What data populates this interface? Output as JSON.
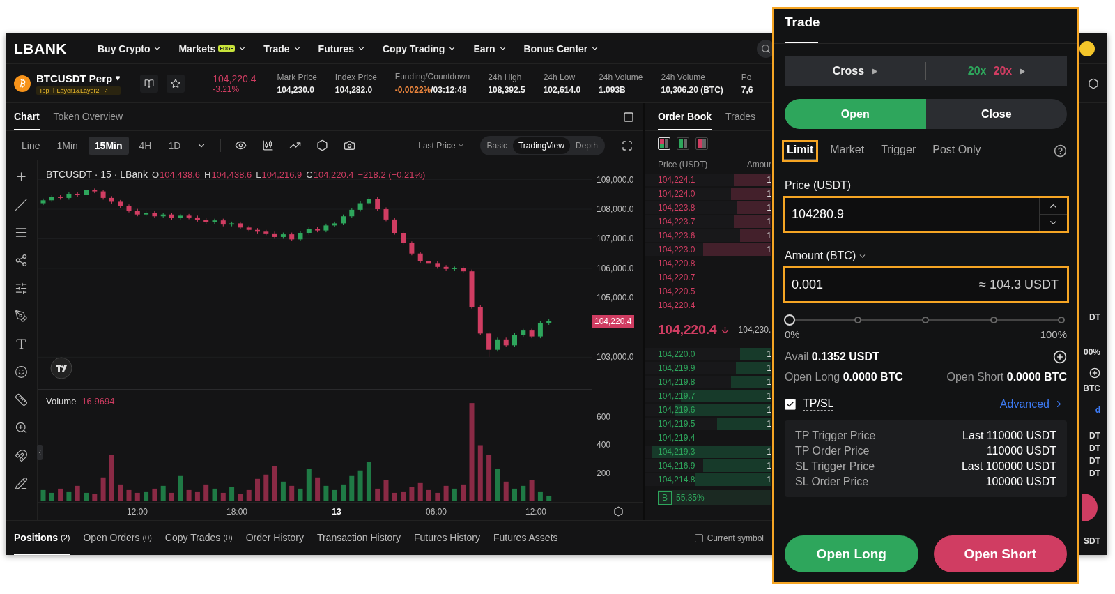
{
  "nav": {
    "logo": "LBANK",
    "items": [
      {
        "label": "Buy Crypto"
      },
      {
        "label": "Markets",
        "badge": "EDGE"
      },
      {
        "label": "Trade"
      },
      {
        "label": "Futures"
      },
      {
        "label": "Copy Trading"
      },
      {
        "label": "Earn"
      },
      {
        "label": "Bonus Center"
      }
    ]
  },
  "ticker": {
    "symbol": "BTCUSDT Perp",
    "tags": [
      "Top",
      "Layer1&Layer2"
    ],
    "price": "104,220.4",
    "change": "-3.21%",
    "stats": [
      {
        "kind": "plain",
        "label": "Mark Price",
        "value": "104,230.0"
      },
      {
        "kind": "plain",
        "label": "Index Price",
        "value": "104,282.0"
      },
      {
        "kind": "funding",
        "label": "Funding/Countdown",
        "value": "-0.0022%",
        "suffix": "/03:12:48"
      },
      {
        "kind": "plain",
        "label": "24h High",
        "value": "108,392.5"
      },
      {
        "kind": "plain",
        "label": "24h Low",
        "value": "102,614.0"
      },
      {
        "kind": "plain",
        "label": "24h Volume",
        "value": "1.093B"
      },
      {
        "kind": "plain",
        "label": "24h Volume",
        "value": "10,306.20 (BTC)"
      },
      {
        "kind": "plain",
        "label": "Po",
        "value": "7,6"
      }
    ]
  },
  "chart": {
    "tabs": [
      {
        "label": "Chart",
        "selected": true
      },
      {
        "label": "Token Overview",
        "selected": false
      }
    ],
    "intervals": [
      {
        "label": "Line",
        "selected": false
      },
      {
        "label": "1Min",
        "selected": false
      },
      {
        "label": "15Min",
        "selected": true
      },
      {
        "label": "4H",
        "selected": false
      },
      {
        "label": "1D",
        "selected": false
      }
    ],
    "price_source": "Last Price",
    "views": [
      {
        "label": "Basic",
        "selected": false
      },
      {
        "label": "TradingView",
        "selected": true
      },
      {
        "label": "Depth",
        "selected": false
      }
    ],
    "legend": {
      "symbol": "BTCUSDT · 15 · LBank",
      "ohlc": [
        {
          "key": "O",
          "value": "104,438.6"
        },
        {
          "key": "H",
          "value": "104,438.6"
        },
        {
          "key": "L",
          "value": "104,216.9"
        },
        {
          "key": "C",
          "value": "104,220.4"
        }
      ],
      "change": "−218.2 (−0.21%)"
    },
    "chart_data": {
      "type": "candlestick",
      "ylim": [
        101900,
        109650
      ],
      "grid": true,
      "yticks": [
        {
          "value": 109000,
          "label": "109,000.0"
        },
        {
          "value": 108000,
          "label": "108,000.0"
        },
        {
          "value": 107000,
          "label": "107,000.0"
        },
        {
          "value": 106000,
          "label": "106,000.0"
        },
        {
          "value": 105000,
          "label": "105,000.0"
        },
        {
          "value": 103000,
          "label": "103,000.0"
        }
      ],
      "ohlc": [
        [
          108200,
          108360,
          108140,
          108300
        ],
        [
          108300,
          108480,
          108240,
          108420
        ],
        [
          108420,
          108480,
          108320,
          108380
        ],
        [
          108380,
          108580,
          108320,
          108520
        ],
        [
          108520,
          108580,
          108420,
          108480
        ],
        [
          108480,
          108700,
          108420,
          108640
        ],
        [
          108640,
          108700,
          108540,
          108600
        ],
        [
          108600,
          108660,
          108320,
          108380
        ],
        [
          108380,
          108440,
          108190,
          108250
        ],
        [
          108250,
          108310,
          108040,
          108100
        ],
        [
          108100,
          108160,
          107890,
          107950
        ],
        [
          107950,
          108010,
          107760,
          107820
        ],
        [
          107820,
          107940,
          107760,
          107880
        ],
        [
          107880,
          107940,
          107700,
          107760
        ],
        [
          107760,
          107880,
          107700,
          107820
        ],
        [
          107820,
          107880,
          107640,
          107700
        ],
        [
          107700,
          107840,
          107640,
          107780
        ],
        [
          107780,
          107840,
          107660,
          107720
        ],
        [
          107720,
          107780,
          107580,
          107640
        ],
        [
          107640,
          107700,
          107500,
          107560
        ],
        [
          107560,
          107680,
          107500,
          107620
        ],
        [
          107620,
          107680,
          107420,
          107480
        ],
        [
          107480,
          107580,
          107420,
          107520
        ],
        [
          107520,
          107580,
          107320,
          107380
        ],
        [
          107380,
          107440,
          107240,
          107300
        ],
        [
          107300,
          107360,
          107180,
          107240
        ],
        [
          107240,
          107300,
          107120,
          107180
        ],
        [
          107180,
          107240,
          107000,
          107060
        ],
        [
          107060,
          107210,
          107000,
          107150
        ],
        [
          107150,
          107210,
          106920,
          106980
        ],
        [
          106980,
          107260,
          106920,
          107200
        ],
        [
          107200,
          107400,
          107140,
          107340
        ],
        [
          107340,
          107400,
          107220,
          107280
        ],
        [
          107280,
          107510,
          107220,
          107450
        ],
        [
          107450,
          107580,
          107390,
          107520
        ],
        [
          107520,
          107820,
          107460,
          107760
        ],
        [
          107760,
          108040,
          107700,
          107980
        ],
        [
          107980,
          108260,
          107920,
          108200
        ],
        [
          108200,
          108410,
          108140,
          108350
        ],
        [
          108350,
          108410,
          107940,
          108000
        ],
        [
          108000,
          108060,
          107590,
          107650
        ],
        [
          107650,
          107710,
          107140,
          107200
        ],
        [
          107200,
          107260,
          106790,
          106850
        ],
        [
          106850,
          106910,
          106440,
          106500
        ],
        [
          106500,
          106560,
          106190,
          106250
        ],
        [
          106250,
          106310,
          106120,
          106180
        ],
        [
          106180,
          106240,
          105990,
          106050
        ],
        [
          106050,
          106110,
          105920,
          105980
        ],
        [
          105980,
          106060,
          105920,
          106000
        ],
        [
          106000,
          106060,
          105840,
          105900
        ],
        [
          105900,
          105960,
          104640,
          104700
        ],
        [
          104700,
          104760,
          103740,
          103800
        ],
        [
          103800,
          103860,
          103010,
          103250
        ],
        [
          103250,
          103660,
          103190,
          103600
        ],
        [
          103600,
          103660,
          103340,
          103400
        ],
        [
          103400,
          103810,
          103340,
          103750
        ],
        [
          103750,
          103960,
          103690,
          103900
        ],
        [
          103900,
          103960,
          103640,
          103700
        ],
        [
          103700,
          104210,
          103640,
          104150
        ],
        [
          104150,
          104300,
          104090,
          104220
        ]
      ]
    },
    "time_axis": [
      {
        "label": "12:00",
        "bold": false
      },
      {
        "label": "18:00",
        "bold": false
      },
      {
        "label": "13",
        "bold": true
      },
      {
        "label": "06:00",
        "bold": false
      },
      {
        "label": "12:00",
        "bold": false
      }
    ],
    "last_price_tag": "104,220.4",
    "volume": {
      "label": "Volume",
      "value": "16.9694",
      "chart_data": {
        "type": "bar",
        "ylim": [
          0,
          790
        ],
        "yticks": [
          {
            "value": 600,
            "label": "600"
          },
          {
            "value": 400,
            "label": "400"
          },
          {
            "value": 200,
            "label": "200"
          }
        ],
        "values": [
          80,
          60,
          90,
          70,
          110,
          60,
          50,
          170,
          330,
          120,
          80,
          60,
          70,
          90,
          110,
          60,
          180,
          80,
          70,
          120,
          90,
          60,
          100,
          50,
          80,
          160,
          190,
          250,
          140,
          110,
          90,
          230,
          170,
          110,
          80,
          120,
          180,
          220,
          280,
          90,
          150,
          60,
          70,
          100,
          130,
          80,
          60,
          110,
          90,
          120,
          700,
          400,
          330,
          230,
          140,
          90,
          110,
          150,
          70,
          40
        ]
      }
    }
  },
  "order_book": {
    "tabs": [
      {
        "label": "Order Book",
        "selected": true
      },
      {
        "label": "Trades",
        "selected": false
      }
    ],
    "layouts": [
      {
        "kind": "both",
        "selected": true
      },
      {
        "kind": "bids",
        "selected": false
      },
      {
        "kind": "asks",
        "selected": false
      }
    ],
    "columns": [
      "Price (USDT)",
      "Amour"
    ],
    "asks": [
      {
        "price": "104,224.1",
        "amount": "1",
        "level": 0.3
      },
      {
        "price": "104,224.0",
        "amount": "1",
        "level": 0.32
      },
      {
        "price": "104,223.8",
        "amount": "1",
        "level": 0.27
      },
      {
        "price": "104,223.7",
        "amount": "1",
        "level": 0.3
      },
      {
        "price": "104,223.6",
        "amount": "1",
        "level": 0.25
      },
      {
        "price": "104,223.0",
        "amount": "1",
        "level": 0.54
      },
      {
        "price": "104,220.8"
      },
      {
        "price": "104,220.7"
      },
      {
        "price": "104,220.5"
      },
      {
        "price": "104,220.4"
      }
    ],
    "mid": {
      "price": "104,220.4",
      "mark": "104,230."
    },
    "bids": [
      {
        "price": "104,220.0",
        "amount": "1",
        "level": 0.25
      },
      {
        "price": "104,219.9",
        "amount": "1",
        "level": 0.28
      },
      {
        "price": "104,219.8",
        "amount": "1",
        "level": 0.32
      },
      {
        "price": "104,219.7",
        "amount": "1",
        "level": 0.72
      },
      {
        "price": "104,219.6",
        "amount": "1",
        "level": 0.77
      },
      {
        "price": "104,219.5",
        "amount": "1",
        "level": 0.43
      },
      {
        "price": "104,219.4"
      },
      {
        "price": "104,219.3",
        "amount": "1",
        "level": 0.95
      },
      {
        "price": "104,216.9",
        "amount": "1",
        "level": 0.54
      },
      {
        "price": "104,214.8",
        "amount": "1",
        "level": 0.6
      }
    ],
    "buy_ratio": {
      "label": "B",
      "value": "55.35%"
    }
  },
  "bottom_tabs": [
    {
      "label": "Positions",
      "count": "(2)",
      "selected": true
    },
    {
      "label": "Open Orders",
      "count": "(0)",
      "selected": false
    },
    {
      "label": "Copy Trades",
      "count": "(0)",
      "selected": false
    },
    {
      "label": "Order History",
      "selected": false
    },
    {
      "label": "Transaction History",
      "selected": false
    },
    {
      "label": "Futures History",
      "selected": false
    },
    {
      "label": "Futures Assets",
      "selected": false
    }
  ],
  "current_symbol": {
    "label": "Current symbol",
    "checked": false
  },
  "side_strip": [
    {
      "kind": "text",
      "text": "DT"
    },
    {
      "kind": "text",
      "text": "00%"
    },
    {
      "kind": "plus"
    },
    {
      "kind": "text",
      "text": "BTC"
    },
    {
      "kind": "link",
      "text": "d"
    },
    {
      "kind": "text",
      "text": "DT"
    },
    {
      "kind": "text",
      "text": "DT"
    },
    {
      "kind": "text",
      "text": "DT"
    },
    {
      "kind": "text",
      "text": "DT"
    },
    {
      "kind": "sell"
    },
    {
      "kind": "text",
      "text": "SDT"
    }
  ],
  "trade": {
    "title": "Trade",
    "margin_mode": "Cross",
    "leverage_long": "20x",
    "leverage_short": "20x",
    "sides": [
      {
        "label": "Open",
        "selected": true
      },
      {
        "label": "Close",
        "selected": false
      }
    ],
    "order_types": [
      {
        "label": "Limit",
        "selected": true,
        "highlighted": true
      },
      {
        "label": "Market",
        "selected": false,
        "highlighted": false
      },
      {
        "label": "Trigger",
        "selected": false,
        "highlighted": false
      },
      {
        "label": "Post Only",
        "selected": false,
        "highlighted": false
      }
    ],
    "price": {
      "label": "Price (USDT)",
      "value": "104280.9",
      "highlighted": true
    },
    "amount": {
      "label": "Amount (BTC)",
      "value": "0.001",
      "estimate": "≈ 104.3 USDT",
      "highlighted": true
    },
    "slider": {
      "level": 0,
      "min_label": "0%",
      "max_label": "100%"
    },
    "avail": {
      "label": "Avail",
      "value": "0.1352 USDT"
    },
    "open_long": {
      "label": "Open Long",
      "value": "0.0000 BTC"
    },
    "open_short": {
      "label": "Open Short",
      "value": "0.0000 BTC"
    },
    "tpsl": {
      "label": "TP/SL",
      "checked": true,
      "link": "Advanced"
    },
    "tpsl_rows": [
      {
        "label": "TP Trigger Price",
        "value": "Last 110000 USDT"
      },
      {
        "label": "TP Order Price",
        "value": "110000 USDT"
      },
      {
        "label": "SL Trigger Price",
        "value": "Last 100000 USDT"
      },
      {
        "label": "SL Order Price",
        "value": "100000 USDT"
      }
    ],
    "buttons": [
      {
        "label": "Open Long",
        "kind": "long"
      },
      {
        "label": "Open Short",
        "kind": "short"
      }
    ]
  }
}
